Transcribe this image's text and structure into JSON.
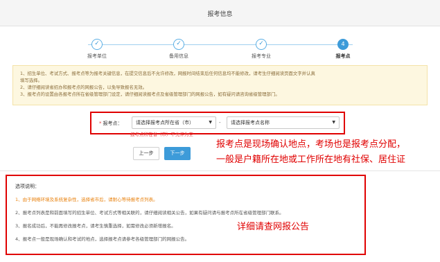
{
  "header": {
    "title": "报考信息"
  },
  "steps": [
    {
      "label": "报考单位",
      "icon": "check-icon",
      "active": false
    },
    {
      "label": "备用信息",
      "icon": "check-icon",
      "active": false
    },
    {
      "label": "报考专业",
      "icon": "check-icon",
      "active": false
    },
    {
      "label": "报考点",
      "number": "4",
      "active": true
    }
  ],
  "notice": {
    "lines": [
      "1、招生单位、考试方式、报考点等为报考关键信息，在提交信息后不允许修改，网报时间结束后任何信息均不能修改，请考生仔细阅读页面文字并认真",
      "填写选择。",
      "2、请仔细阅读省招办和报考点的网报公告，以免导致报名无效。",
      "3、报考点的设置由各报考点所在省级管理部门设定，请仔细阅读报考点及省级管理部门的网报公告，如有疑问请咨询省级管理部门。"
    ]
  },
  "form": {
    "label": "报考点：",
    "required_mark": "*",
    "province_select": {
      "value": "请选择报考点所在省（市）"
    },
    "separator": "-",
    "site_select": {
      "value": "请选择报考点名称"
    },
    "error": "报考点所在省（市）不允许为空"
  },
  "buttons": {
    "prev": "上一步",
    "next": "下一步"
  },
  "annotations": {
    "line1": "报考点是现场确认地点，考场也是报考点分配，",
    "line2": "一般是户籍所在地或工作所在地有社保、居住证",
    "line3": "详细请查网报公告"
  },
  "description": {
    "title": "选项说明：",
    "items": [
      "1、由于网络环境及系统复杂性，选择省市后，请耐心等待报考点列表。",
      "2、报考点列表是和前面填写的招生单位、考试方式等相关联的，请仔细阅读相关公告，如果有疑问请与报考点所在省级管理部门联系。",
      "3、报名成功后，不能再修改报考点，请考生慎重选择，如需修改必须新增报名。",
      "4、报考点一般是现场确认和考试的地点，选择报考点请参考各级管理部门的网报公告。"
    ]
  },
  "colors": {
    "accent": "#3d9bd9",
    "annotation_red": "#e00000",
    "warning_bg": "#fdf7e0",
    "orange": "#e8800c"
  }
}
